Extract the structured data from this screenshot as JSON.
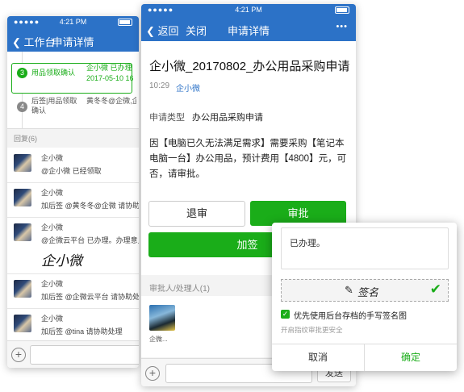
{
  "status": {
    "time": "4:21 PM"
  },
  "back_screen": {
    "nav": {
      "back_label": "工作台",
      "title": "申请详情"
    },
    "steps": [
      {
        "num": "3",
        "label": "用品领取确认",
        "person": "企小微 已办理",
        "time": "2017-05-10 16:3"
      },
      {
        "num": "4",
        "label": "后签|用品领取确认",
        "person": "黄冬冬@企微,企微"
      }
    ],
    "reply_header": "回复(6)",
    "replies": [
      {
        "name": "企小微",
        "text": "@企小微  已经领取"
      },
      {
        "name": "企小微",
        "text": "加后签  @黄冬冬@企微  请协助"
      },
      {
        "name": "企小微",
        "text": "@企微云平台  已办理。办理意见",
        "signature": "企小微"
      },
      {
        "name": "企小微",
        "text": "加后签  @企微云平台  请协助处理"
      },
      {
        "name": "企小微",
        "text": "加后签  @tina  请协助处理"
      }
    ]
  },
  "front_screen": {
    "nav": {
      "back_label": "返回",
      "close_label": "关闭",
      "title": "申请详情",
      "more": "•••"
    },
    "title": "企小微_20170802_办公用品采购申请",
    "meta_time": "10:29",
    "meta_user": "企小微",
    "type_label": "申请类型",
    "type_value": "办公用品采购申请",
    "body": "因【电脑已久无法满足需求】需要采购【笔记本电脑一台】办公用品，预计费用【4800】元，可否，请审批。",
    "btn_return": "退审",
    "btn_approve": "审批",
    "btn_addsign": "加签",
    "approver_header": "审批人/处理人(1)",
    "approver_name": "企微...",
    "send_label": "发送"
  },
  "modal": {
    "opinion": "已办理。",
    "signature_text": "签名",
    "option_label": "优先使用后台存档的手写签名图",
    "fingerprint_hint": "开启指纹审批更安全",
    "cancel": "取消",
    "confirm": "确定"
  },
  "colors": {
    "nav": "#2c72c7",
    "green": "#1aad19",
    "step_green": "#1aad19",
    "blue_link": "#2c72c7"
  }
}
